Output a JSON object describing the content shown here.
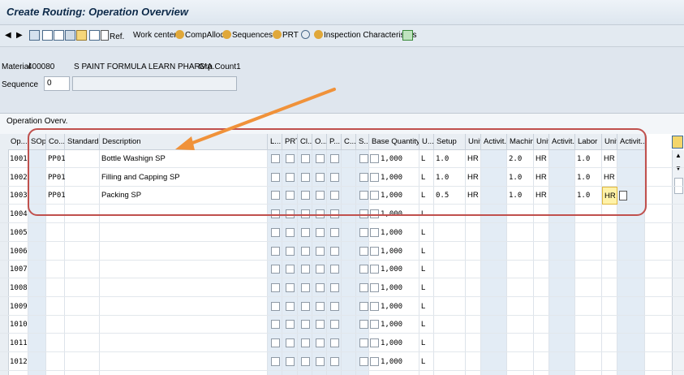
{
  "title": "Create Routing: Operation Overview",
  "toolbar": {
    "ref": "Ref.",
    "work_center": "Work center",
    "comp_alloc": "CompAlloc",
    "sequences": "Sequences",
    "prt": "PRT",
    "inspection": "Inspection Characteristics"
  },
  "header": {
    "material_label": "Material",
    "material_value": "400080",
    "material_desc": "S PAINT FORMULA LEARN PHARMA",
    "grp_count": "Grp.Count1",
    "sequence_label": "Sequence",
    "sequence_value": "0"
  },
  "panel": {
    "title": "Operation Overv."
  },
  "columns": [
    "Op...",
    "SOp",
    "Co...",
    "Standard...",
    "Description",
    "L...",
    "PRT",
    "Cl...",
    "O...",
    "P...",
    "C...",
    "S...",
    "Base Quantity",
    "U...",
    "Setup",
    "Unit",
    "Activit...",
    "Machine",
    "Unit",
    "Activit...",
    "Labor",
    "Unit",
    "Activit..."
  ],
  "rows": [
    {
      "op": "1001",
      "ctrl": "PP01",
      "desc": "Bottle Washign SP",
      "qty": "1,000",
      "u": "L",
      "setup": "1.0",
      "setup_unit": "HR",
      "machine": "2.0",
      "machine_unit": "HR",
      "labor": "1.0",
      "labor_unit": "HR"
    },
    {
      "op": "1002",
      "ctrl": "PP01",
      "desc": "Filling and Capping SP",
      "qty": "1,000",
      "u": "L",
      "setup": "1.0",
      "setup_unit": "HR",
      "machine": "1.0",
      "machine_unit": "HR",
      "labor": "1.0",
      "labor_unit": "HR"
    },
    {
      "op": "1003",
      "ctrl": "PP01",
      "desc": "Packing SP",
      "qty": "1,000",
      "u": "L",
      "setup": "0.5",
      "setup_unit": "HR",
      "machine": "1.0",
      "machine_unit": "HR",
      "labor": "1.0",
      "labor_unit": "HR"
    },
    {
      "op": "1004",
      "ctrl": "",
      "desc": "",
      "qty": "1,000",
      "u": "L",
      "setup": "",
      "setup_unit": "",
      "machine": "",
      "machine_unit": "",
      "labor": "",
      "labor_unit": ""
    },
    {
      "op": "1005",
      "ctrl": "",
      "desc": "",
      "qty": "1,000",
      "u": "L",
      "setup": "",
      "setup_unit": "",
      "machine": "",
      "machine_unit": "",
      "labor": "",
      "labor_unit": ""
    },
    {
      "op": "1006",
      "ctrl": "",
      "desc": "",
      "qty": "1,000",
      "u": "L",
      "setup": "",
      "setup_unit": "",
      "machine": "",
      "machine_unit": "",
      "labor": "",
      "labor_unit": ""
    },
    {
      "op": "1007",
      "ctrl": "",
      "desc": "",
      "qty": "1,000",
      "u": "L",
      "setup": "",
      "setup_unit": "",
      "machine": "",
      "machine_unit": "",
      "labor": "",
      "labor_unit": ""
    },
    {
      "op": "1008",
      "ctrl": "",
      "desc": "",
      "qty": "1,000",
      "u": "L",
      "setup": "",
      "setup_unit": "",
      "machine": "",
      "machine_unit": "",
      "labor": "",
      "labor_unit": ""
    },
    {
      "op": "1009",
      "ctrl": "",
      "desc": "",
      "qty": "1,000",
      "u": "L",
      "setup": "",
      "setup_unit": "",
      "machine": "",
      "machine_unit": "",
      "labor": "",
      "labor_unit": ""
    },
    {
      "op": "1010",
      "ctrl": "",
      "desc": "",
      "qty": "1,000",
      "u": "L",
      "setup": "",
      "setup_unit": "",
      "machine": "",
      "machine_unit": "",
      "labor": "",
      "labor_unit": ""
    },
    {
      "op": "1011",
      "ctrl": "",
      "desc": "",
      "qty": "1,000",
      "u": "L",
      "setup": "",
      "setup_unit": "",
      "machine": "",
      "machine_unit": "",
      "labor": "",
      "labor_unit": ""
    },
    {
      "op": "1012",
      "ctrl": "",
      "desc": "",
      "qty": "1,000",
      "u": "L",
      "setup": "",
      "setup_unit": "",
      "machine": "",
      "machine_unit": "",
      "labor": "",
      "labor_unit": ""
    }
  ],
  "colors": {
    "annotation_box": "#c0504d",
    "annotation_arrow": "#f0923a",
    "highlight_cell": "#fff2a8"
  }
}
